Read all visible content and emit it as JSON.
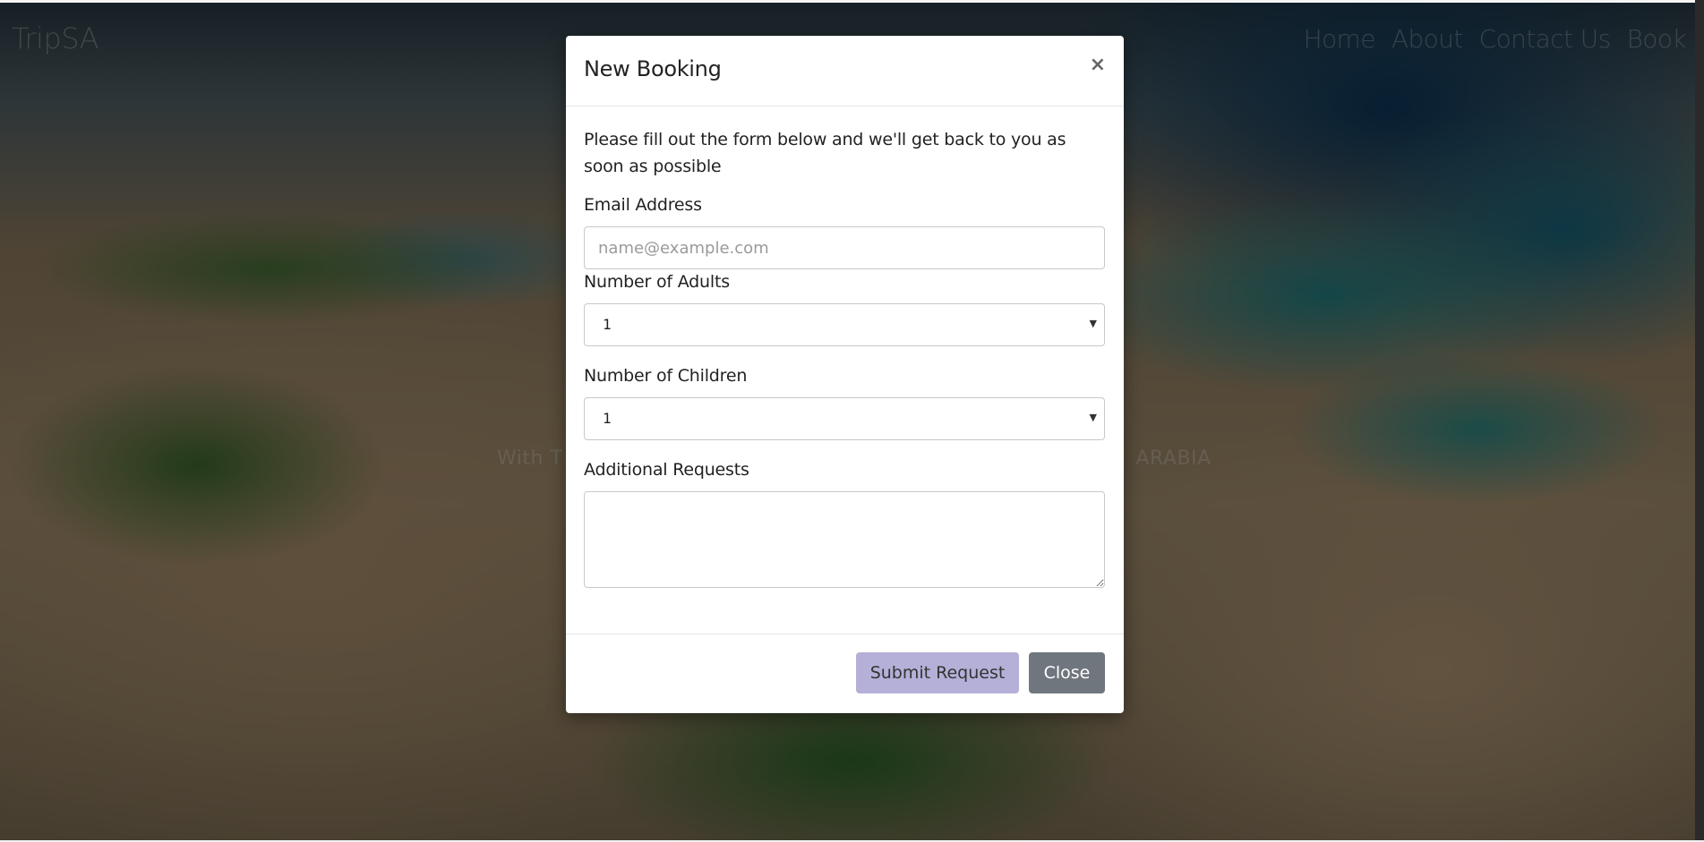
{
  "navbar": {
    "brand": "TripSA",
    "links": [
      "Home",
      "About",
      "Contact Us",
      "Book"
    ]
  },
  "hero": {
    "left_fragment": "With T",
    "right_fragment": "ARABIA"
  },
  "modal": {
    "title": "New Booking",
    "close_icon": "×",
    "intro": "Please fill out the form below and we'll get back to you as soon as possible",
    "email": {
      "label": "Email Address",
      "placeholder": "name@example.com",
      "value": ""
    },
    "adults": {
      "label": "Number of Adults",
      "value": "1"
    },
    "children": {
      "label": "Number of Children",
      "value": "1"
    },
    "requests": {
      "label": "Additional Requests",
      "value": ""
    },
    "buttons": {
      "submit": "Submit Request",
      "close": "Close"
    }
  },
  "colors": {
    "submit_bg": "#b4b0d8",
    "close_bg": "#6f767d",
    "overlay": "rgba(0,0,0,0.5)"
  }
}
